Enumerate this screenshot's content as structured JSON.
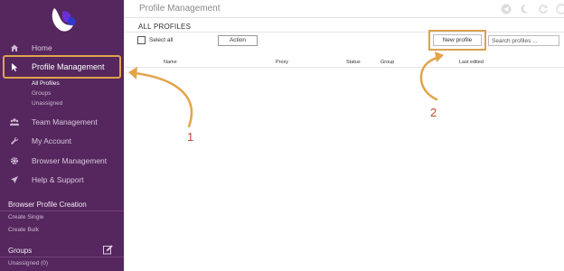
{
  "header": {
    "title": "Profile Management"
  },
  "sidebar": {
    "nav": [
      {
        "label": "Home",
        "icon": "home-icon"
      },
      {
        "label": "Profile Management",
        "icon": "cursor-icon"
      },
      {
        "label": "Team Management",
        "icon": "team-icon"
      },
      {
        "label": "My Account",
        "icon": "wrench-icon"
      },
      {
        "label": "Browser Management",
        "icon": "gear-icon"
      },
      {
        "label": "Help & Support",
        "icon": "send-icon"
      }
    ],
    "profile_sub": [
      "All Profiles",
      "Groups",
      "Unassigned"
    ],
    "creation": {
      "title": "Browser Profile Creation",
      "links": [
        "Create Single",
        "Create Bulk"
      ]
    },
    "groups": {
      "title": "Groups",
      "items": [
        "Unassigned (0)"
      ]
    }
  },
  "main": {
    "page_title": "ALL PROFILES",
    "select_all": "Select all",
    "action": "Action",
    "new_profile": "New profile",
    "search_placeholder": "Search profiles ...",
    "columns": [
      "Name",
      "Proxy",
      "Status",
      "Group",
      "Last edited"
    ]
  },
  "annotations": [
    "1",
    "2"
  ],
  "colors": {
    "sidebar": "#55275e",
    "highlight": "#e0a34c",
    "annotation_text": "#c04a2a"
  }
}
